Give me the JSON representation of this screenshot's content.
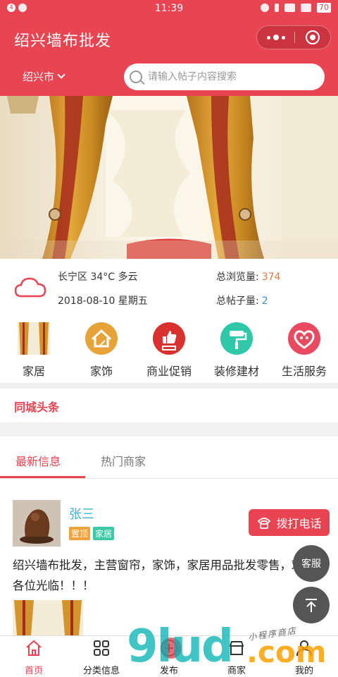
{
  "status_bar": {
    "time": "11:39",
    "left_badge": "4",
    "battery": "70"
  },
  "header": {
    "title": "绍兴墙布批发",
    "city": "绍兴市",
    "search_placeholder": "请输入帖子内容搜索"
  },
  "stats": {
    "weather": "长宁区 34°C 多云",
    "date": "2018-08-10 星期五",
    "views_label": "总浏览量:",
    "views_value": "374",
    "posts_label": "总帖子量:",
    "posts_value": "2"
  },
  "categories": [
    {
      "label": "家居",
      "icon": "curtain-photo-icon"
    },
    {
      "label": "家饰",
      "icon": "house-broom-icon",
      "color": "#e8a23a"
    },
    {
      "label": "商业促销",
      "icon": "thumbs-up-100-icon",
      "color": "#d9322e"
    },
    {
      "label": "装修建材",
      "icon": "paint-roller-icon",
      "color": "#2fc8a8"
    },
    {
      "label": "生活服务",
      "icon": "heart-people-icon",
      "color": "#e84a5f"
    }
  ],
  "headline": {
    "title": "同城头条"
  },
  "tabs": [
    {
      "label": "最新信息",
      "active": true
    },
    {
      "label": "热门商家",
      "active": false
    }
  ],
  "post": {
    "name": "张三",
    "badges": [
      {
        "label": "置顶",
        "color": "#f0a33a"
      },
      {
        "label": "家居",
        "color": "#3cc9a6"
      }
    ],
    "call_label": "拨打电话",
    "text": "绍兴墙布批发，主营窗帘，家饰，家居用品批发零售，欢迎各位光临！！！"
  },
  "fab": {
    "service_label": "客服"
  },
  "bottom_nav": [
    {
      "label": "首页",
      "icon": "home-icon",
      "active": true
    },
    {
      "label": "分类信息",
      "icon": "grid-icon",
      "active": false
    },
    {
      "label": "发布",
      "icon": "plus-icon",
      "active": false
    },
    {
      "label": "商家",
      "icon": "shop-icon",
      "active": false
    },
    {
      "label": "我的",
      "icon": "user-icon",
      "active": false
    }
  ],
  "watermark": {
    "big": "9lud",
    "com": ".com",
    "small": "小程序商店"
  },
  "colors": {
    "primary": "#e94452",
    "link": "#3ab4d4",
    "views": "#e07a45",
    "posts": "#3d8fd6"
  }
}
